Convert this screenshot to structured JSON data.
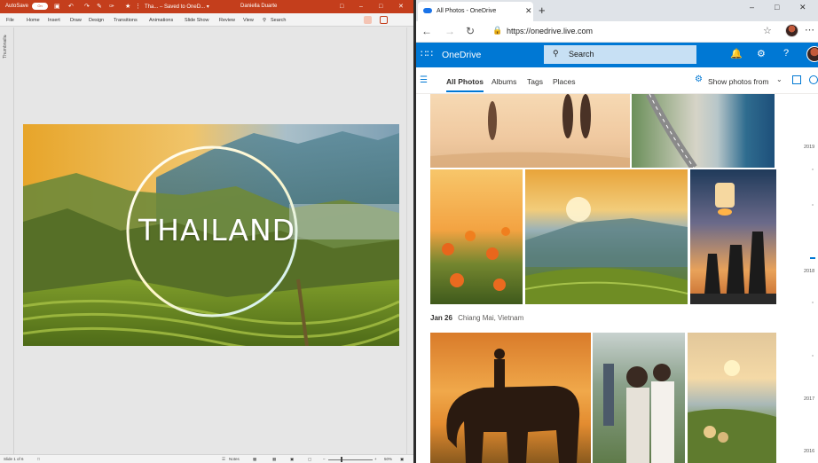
{
  "ppt": {
    "autosave_label": "AutoSave",
    "autosave_toggle": "On",
    "doc_title": "Tha... – Saved to OneD... ▾",
    "user_name": "Daniella Duarte",
    "ribbon_tabs": [
      "File",
      "Home",
      "Insert",
      "Draw",
      "Design",
      "Transitions",
      "Animations",
      "Slide Show",
      "Review",
      "View"
    ],
    "tell_me": "Search",
    "thumbnails_label": "Thumbnails",
    "slide_title": "THAILAND",
    "status_slide": "Slide 1 of 6",
    "status_notes": "Notes",
    "zoom_level": "50%"
  },
  "edge": {
    "tab_title": "All Photos - OneDrive",
    "url": "https://onedrive.live.com"
  },
  "onedrive": {
    "brand": "OneDrive",
    "search_placeholder": "Search",
    "tabs": [
      "All Photos",
      "Albums",
      "Tags",
      "Places"
    ],
    "show_photos_from": "Show photos from",
    "group_date": "Jan 26",
    "group_location": "Chiang Mai, Vietnam",
    "timeline_years": [
      "2019",
      "2018",
      "2017",
      "2016"
    ]
  },
  "colors": {
    "ppt_accent": "#c43e1c",
    "onedrive_blue": "#0078d4"
  }
}
